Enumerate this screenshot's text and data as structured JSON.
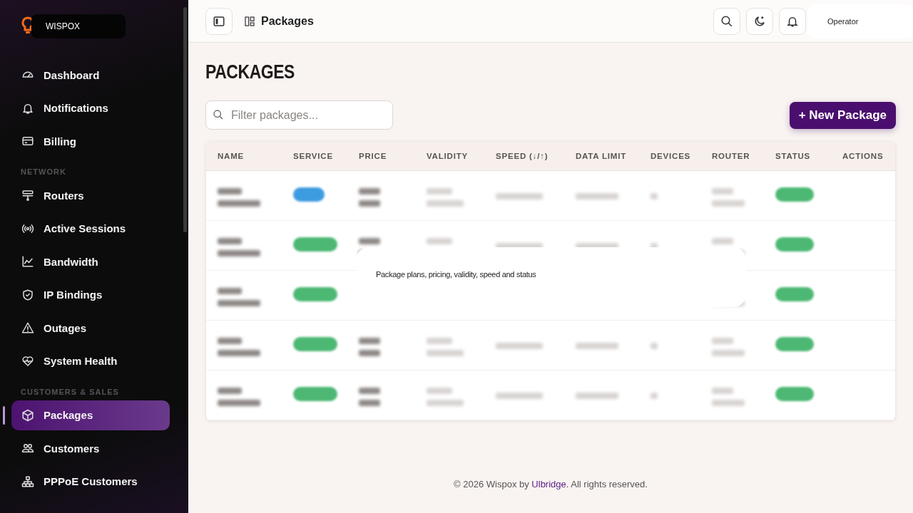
{
  "brand": {
    "name": "WISPOX"
  },
  "sidebar": {
    "sections": [
      {
        "items": [
          {
            "label": "Dashboard",
            "selected": false
          },
          {
            "label": "Notifications",
            "selected": false
          },
          {
            "label": "Billing",
            "selected": false
          }
        ]
      },
      {
        "title": "NETWORK",
        "items": [
          {
            "label": "Routers",
            "selected": false
          },
          {
            "label": "Active Sessions",
            "selected": false
          },
          {
            "label": "Bandwidth",
            "selected": false
          },
          {
            "label": "IP Bindings",
            "selected": false
          },
          {
            "label": "Outages",
            "selected": false
          },
          {
            "label": "System Health",
            "selected": false
          }
        ]
      },
      {
        "title": "CUSTOMERS & SALES",
        "items": [
          {
            "label": "Packages",
            "selected": true
          },
          {
            "label": "Customers",
            "selected": false
          },
          {
            "label": "PPPoE Customers",
            "selected": false
          }
        ]
      }
    ]
  },
  "header": {
    "title": "Packages",
    "user": "Operator"
  },
  "page": {
    "title": "PACKAGES",
    "filter": {
      "placeholder": "Filter packages..."
    },
    "new_button": "+ New Package"
  },
  "table": {
    "columns": [
      "NAME",
      "SERVICE",
      "PRICE",
      "VALIDITY",
      "SPEED (↓/↑)",
      "DATA LIMIT",
      "DEVICES",
      "ROUTER",
      "STATUS",
      "ACTIONS"
    ],
    "rows": [
      {
        "service": {
          "color": "#3d9be0"
        },
        "status": {
          "color": "#4cb873"
        }
      },
      {
        "service": {
          "color": "#4cb873"
        },
        "status": {
          "color": "#4cb873"
        }
      },
      {
        "service": {
          "color": "#4cb873"
        },
        "status": {
          "color": "#4cb873"
        }
      },
      {
        "service": {
          "color": "#4cb873"
        },
        "status": {
          "color": "#4cb873"
        }
      },
      {
        "service": {
          "color": "#4cb873"
        },
        "status": {
          "color": "#4cb873"
        }
      }
    ]
  },
  "tooltip": "Package plans, pricing, validity, speed and status",
  "footer": {
    "before": "© 2026 Wispox by",
    "link": "Ulbridge",
    "after": ". All rights reserved."
  }
}
